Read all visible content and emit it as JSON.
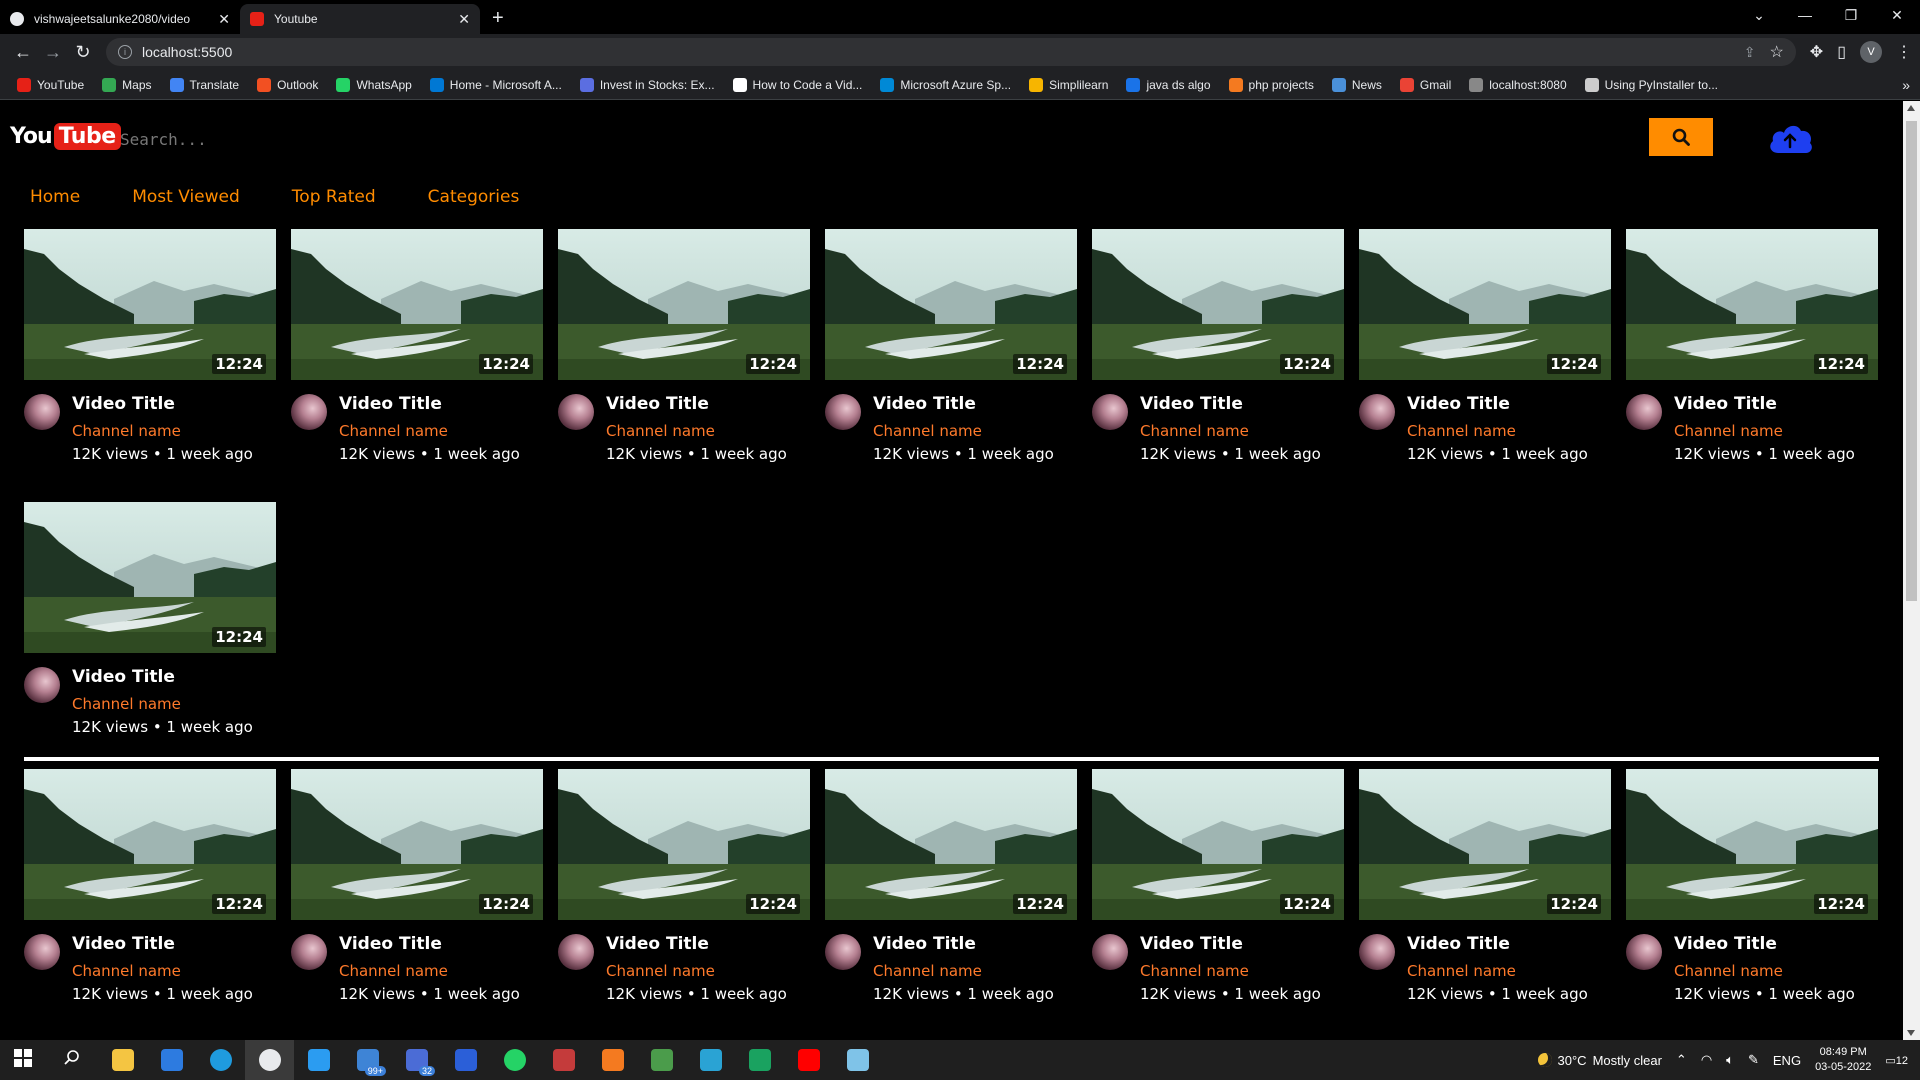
{
  "browser": {
    "tabs": [
      {
        "title": "vishwajeetsalunke2080/video",
        "favicon_color": "#e8eaed",
        "active": false
      },
      {
        "title": "Youtube",
        "favicon_color": "#e62117",
        "active": true
      }
    ],
    "new_tab_icon": "plus-icon",
    "url": "localhost:5500",
    "profile_initial": "V"
  },
  "bookmarks": [
    {
      "label": "YouTube",
      "color": "#e62117"
    },
    {
      "label": "Maps",
      "color": "#34a853"
    },
    {
      "label": "Translate",
      "color": "#4285f4"
    },
    {
      "label": "Outlook",
      "color": "#f25022"
    },
    {
      "label": "WhatsApp",
      "color": "#25d366"
    },
    {
      "label": "Home - Microsoft A...",
      "color": "#0078d4"
    },
    {
      "label": "Invest in Stocks: Ex...",
      "color": "#5b6ee1"
    },
    {
      "label": "How to Code a Vid...",
      "color": "#ffffff"
    },
    {
      "label": "Microsoft Azure Sp...",
      "color": "#0089d6"
    },
    {
      "label": "Simplilearn",
      "color": "#f7b500"
    },
    {
      "label": "java ds algo",
      "color": "#1a73e8"
    },
    {
      "label": "php projects",
      "color": "#f47a20"
    },
    {
      "label": "News",
      "color": "#4a90d9"
    },
    {
      "label": "Gmail",
      "color": "#ea4335"
    },
    {
      "label": "localhost:8080",
      "color": "#888888"
    },
    {
      "label": "Using PyInstaller to...",
      "color": "#cccccc"
    }
  ],
  "header": {
    "logo_you": "You",
    "logo_tube": "Tube",
    "search_placeholder": "Search...",
    "search_icon": "search-icon",
    "upload_icon": "cloud-upload-icon"
  },
  "nav": {
    "items": [
      "Home",
      "Most Viewed",
      "Top Rated",
      "Categories"
    ]
  },
  "video_card": {
    "title": "Video Title",
    "channel": "Channel name",
    "stats": "12K views • 1 week ago",
    "duration": "12:24"
  },
  "sections": [
    {
      "card_count": 8
    },
    {
      "card_count": 7
    }
  ],
  "colors": {
    "accent": "#ff8c00",
    "channel": "#ff7a2b",
    "background": "#000000",
    "logo_red": "#e62117"
  },
  "taskbar": {
    "weather_temp": "30°C",
    "weather_desc": "Mostly clear",
    "language": "ENG",
    "time": "08:49 PM",
    "date": "03-05-2022",
    "notifications": "12",
    "apps": [
      {
        "name": "start-icon"
      },
      {
        "name": "search-icon"
      },
      {
        "name": "file-explorer-icon"
      },
      {
        "name": "store-icon"
      },
      {
        "name": "edge-icon"
      },
      {
        "name": "chrome-icon",
        "active": true
      },
      {
        "name": "vscode-icon"
      },
      {
        "name": "mail-icon",
        "badge": "99+"
      },
      {
        "name": "teams-icon",
        "badge": "32"
      },
      {
        "name": "word-icon"
      },
      {
        "name": "whatsapp-icon"
      },
      {
        "name": "calendar-icon"
      },
      {
        "name": "xampp-icon"
      },
      {
        "name": "git-icon"
      },
      {
        "name": "virtualbox-icon"
      },
      {
        "name": "app-icon"
      },
      {
        "name": "youtube-icon"
      },
      {
        "name": "notepad-icon"
      }
    ]
  }
}
